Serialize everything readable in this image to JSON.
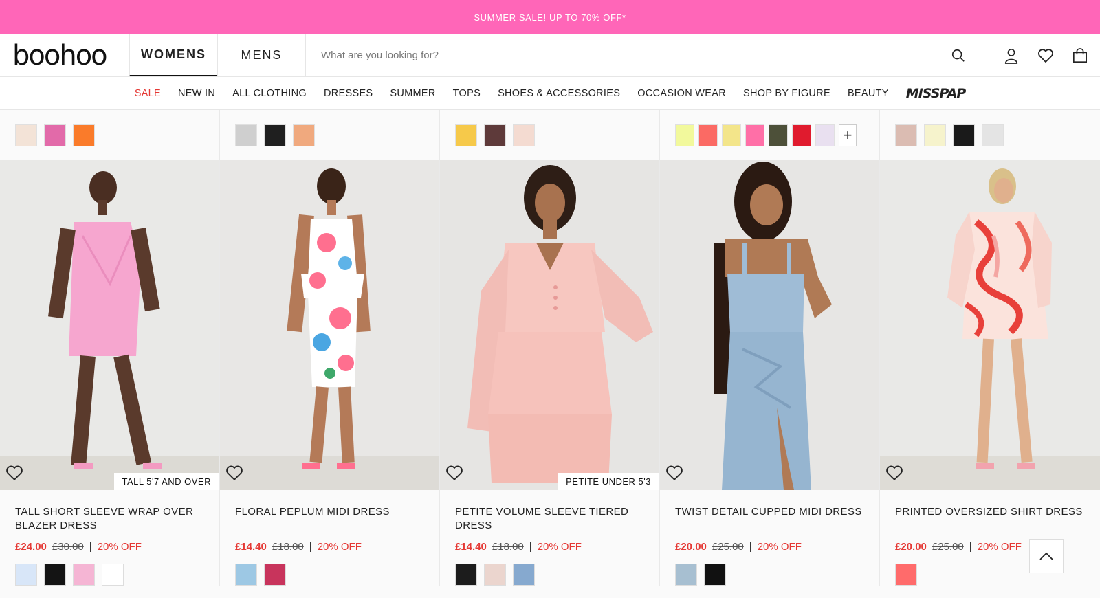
{
  "promo": {
    "text": "SUMMER SALE! UP TO 70% OFF*",
    "bg": "#ff66b8"
  },
  "header": {
    "logo": "boohoo",
    "tabs": [
      "WOMENS",
      "MENS"
    ],
    "search": {
      "placeholder": "What are you looking for?",
      "value": ""
    },
    "icons": [
      "search-icon",
      "account-icon",
      "wishlist-heart-icon",
      "bag-icon"
    ]
  },
  "nav": {
    "items": [
      "SALE",
      "NEW IN",
      "ALL CLOTHING",
      "DRESSES",
      "SUMMER",
      "TOPS",
      "SHOES & ACCESSORIES",
      "OCCASION WEAR",
      "SHOP BY FIGURE",
      "BEAUTY"
    ],
    "brand": "MISSPAP"
  },
  "top_swatches": [
    [
      "#f3e3d7",
      "#e26aa9",
      "#fa7b2a"
    ],
    [
      "#cfcfcf",
      "#1f1f1f",
      "#f0a97e"
    ],
    [
      "#f6c94a",
      "#5e3a3a",
      "#f4dbd1"
    ],
    [
      "#f2f99c",
      "#fb6a64",
      "#f3e58a",
      "#ff6fa7",
      "#4d5039",
      "#e01b2e",
      "#e9e0f0"
    ],
    [
      "#dbbcb2",
      "#f6f3cc",
      "#1a1a1a",
      "#e4e4e4"
    ]
  ],
  "more_colors_label": "+",
  "products": [
    {
      "title": "TALL SHORT SLEEVE WRAP OVER BLAZER DRESS",
      "price": "£24.00",
      "was": "£30.00",
      "sep": "|",
      "discount": "20% OFF",
      "badge": "TALL 5'7 AND OVER",
      "swatches": [
        "#d8e6f8",
        "#141414",
        "#f5b5d4",
        "#ffffff"
      ]
    },
    {
      "title": "FLORAL PEPLUM MIDI DRESS",
      "price": "£14.40",
      "was": "£18.00",
      "sep": "|",
      "discount": "20% OFF",
      "badge": "",
      "swatches": [
        "#9dc8e4",
        "#c8345c"
      ]
    },
    {
      "title": "PETITE VOLUME SLEEVE TIERED DRESS",
      "price": "£14.40",
      "was": "£18.00",
      "sep": "|",
      "discount": "20% OFF",
      "badge": "PETITE UNDER 5'3",
      "swatches": [
        "#1c1c1c",
        "#ebd5ce",
        "#86a9cf"
      ]
    },
    {
      "title": "TWIST DETAIL CUPPED MIDI DRESS",
      "price": "£20.00",
      "was": "£25.00",
      "sep": "|",
      "discount": "20% OFF",
      "badge": "",
      "swatches": [
        "#a7bfd1",
        "#111111"
      ]
    },
    {
      "title": "PRINTED OVERSIZED SHIRT DRESS",
      "price": "£20.00",
      "was": "£25.00",
      "sep": "|",
      "discount": "20% OFF",
      "badge": "",
      "swatches": [
        "#ff6b6b"
      ]
    }
  ],
  "colors": {
    "accent": "#ff66b8",
    "sale_red": "#e53935"
  }
}
